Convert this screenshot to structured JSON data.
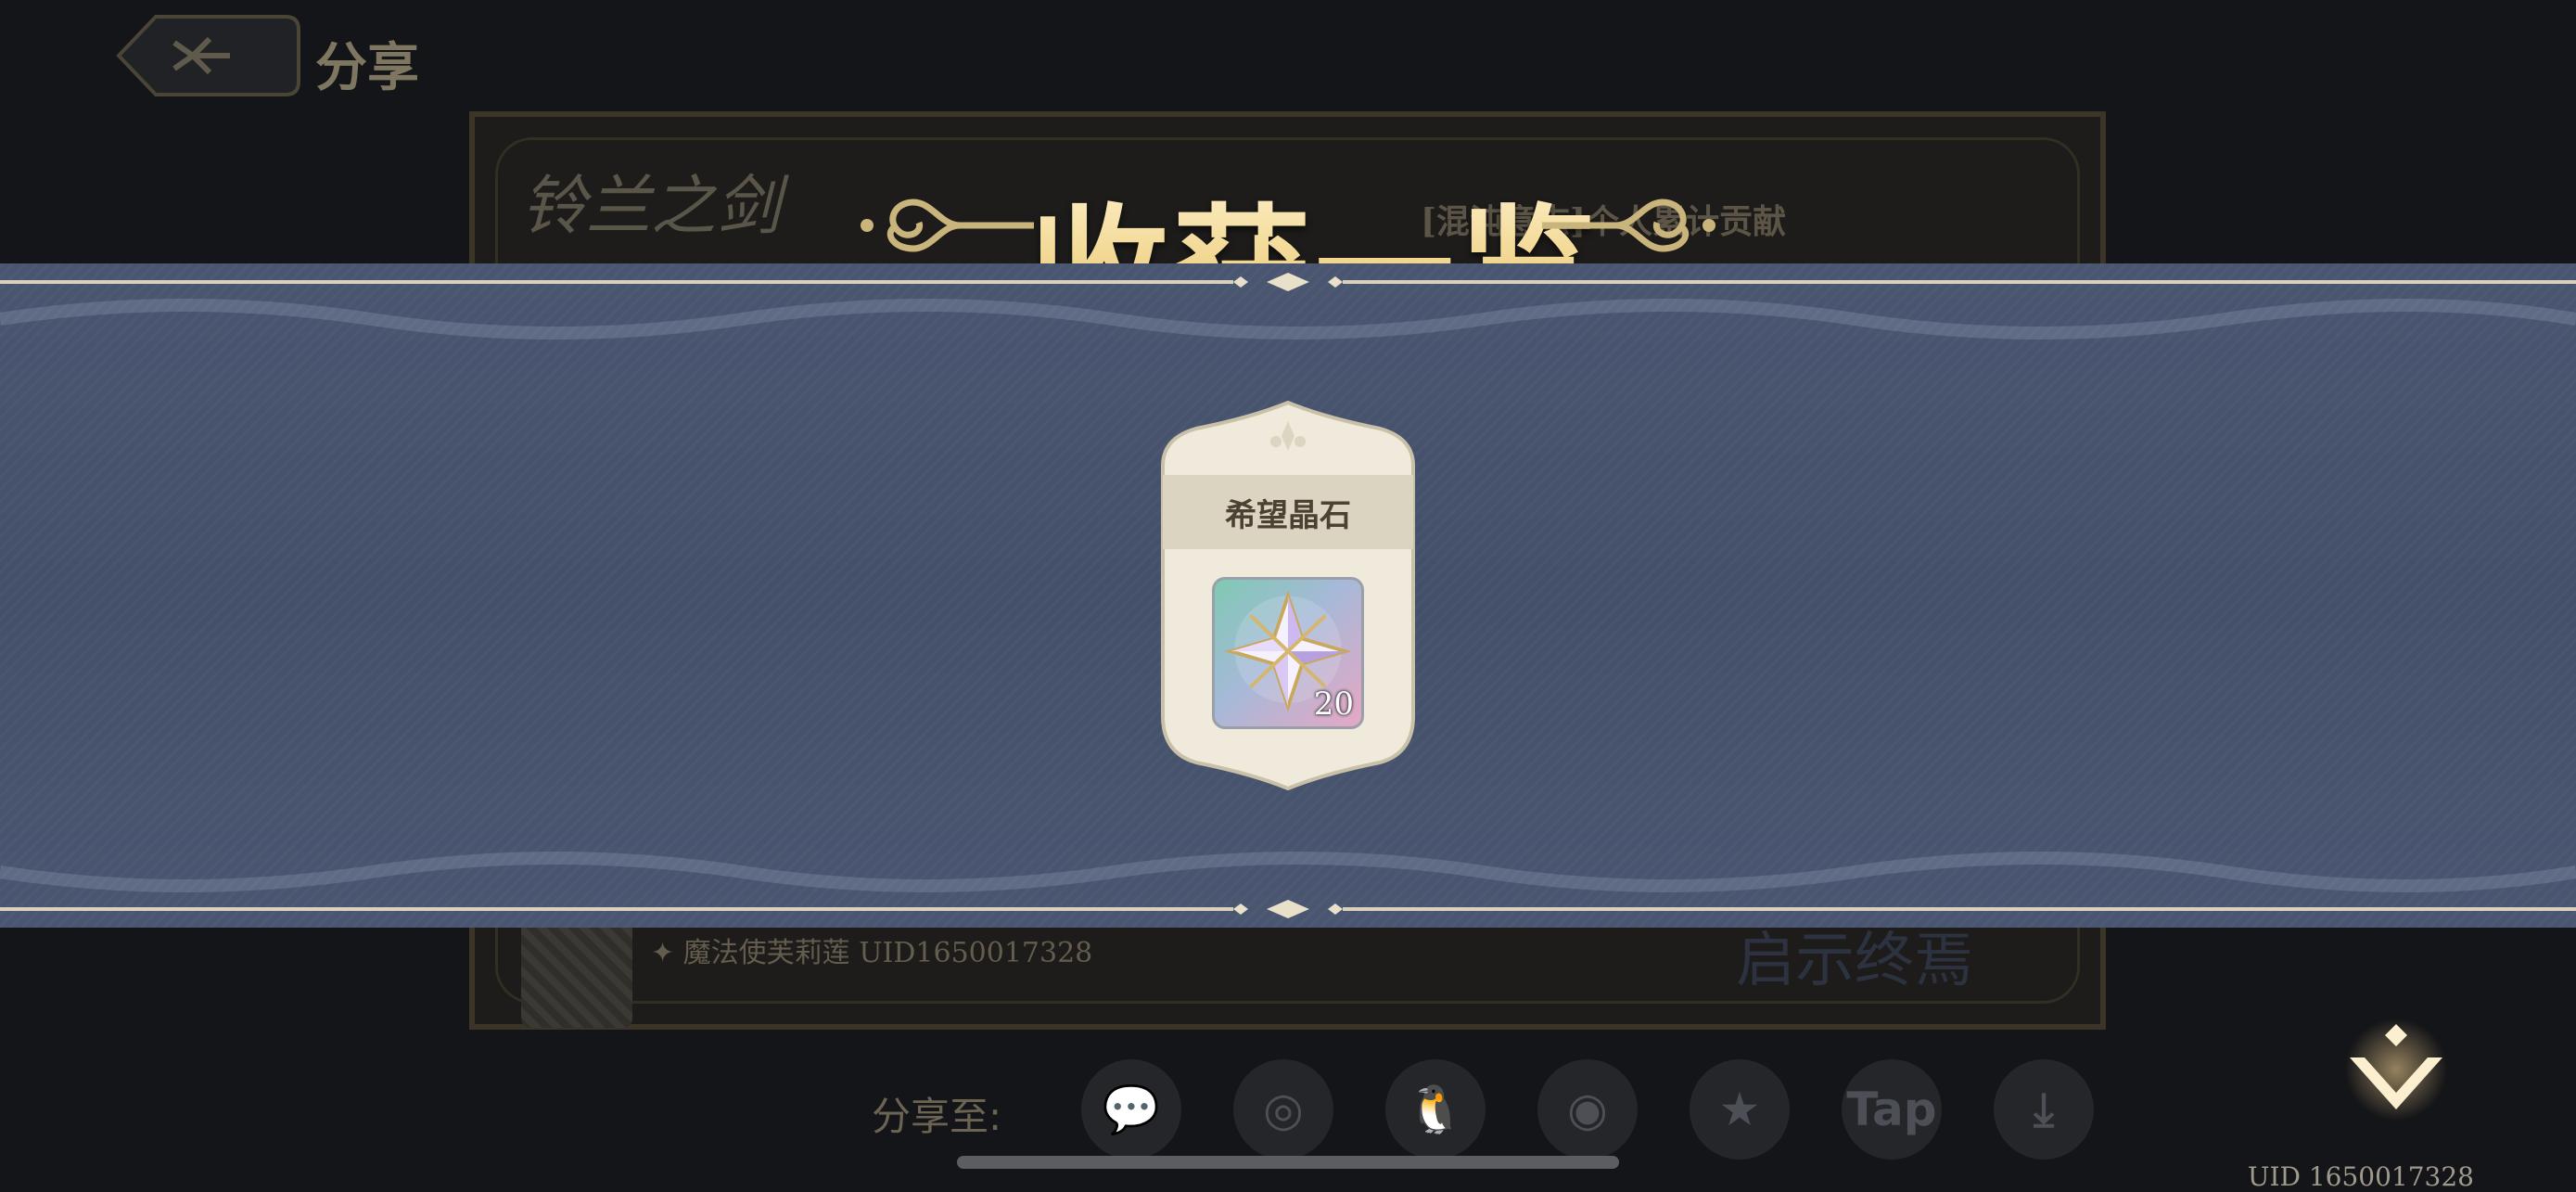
{
  "background": {
    "back_label": "分享",
    "card": {
      "title": "铃兰之剑",
      "contribution_heading": "[混沌意志]个人累计贡献",
      "author_line": "✦ 魔法使芙莉莲 UID1650017328",
      "phrase": "启示终焉"
    },
    "share": {
      "label": "分享至:",
      "targets": [
        {
          "name": "wechat-icon",
          "glyph": "💬"
        },
        {
          "name": "moments-icon",
          "glyph": "◎"
        },
        {
          "name": "qq-icon",
          "glyph": "🐧"
        },
        {
          "name": "weibo-icon",
          "glyph": "◉"
        },
        {
          "name": "qzone-icon",
          "glyph": "★"
        },
        {
          "name": "taptap-icon",
          "glyph": "Tap"
        },
        {
          "name": "download-icon",
          "glyph": "⤓"
        }
      ]
    },
    "uid_footer": "UID 1650017328"
  },
  "overlay": {
    "title": "收获一览",
    "rewards": [
      {
        "name": "希望晶石",
        "quantity": "20",
        "icon": "hope-crystal-icon"
      }
    ]
  },
  "colors": {
    "banner": "#465270",
    "gold_title": "#f0d48b",
    "card_bg": "#efeadb"
  }
}
